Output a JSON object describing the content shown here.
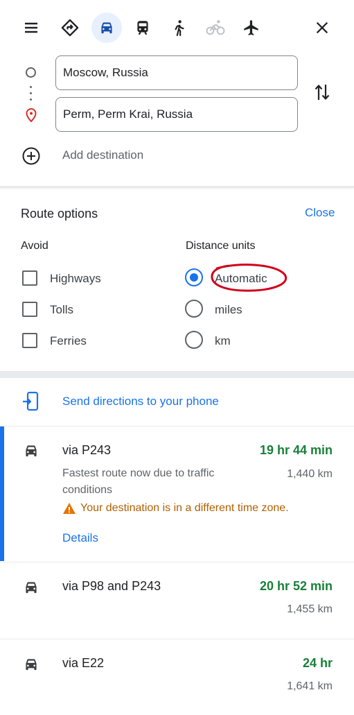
{
  "modes": {
    "menu_icon": "menu-icon",
    "items": [
      {
        "name": "best-route-icon"
      },
      {
        "name": "driving-icon",
        "active": true
      },
      {
        "name": "transit-icon"
      },
      {
        "name": "walking-icon"
      },
      {
        "name": "cycling-icon",
        "disabled": true
      },
      {
        "name": "flights-icon"
      }
    ],
    "close_icon": "close-icon"
  },
  "directions": {
    "origin": "Moscow, Russia",
    "destination": "Perm, Perm Krai, Russia",
    "add_destination": "Add destination"
  },
  "route_options": {
    "title": "Route options",
    "close": "Close",
    "avoid_label": "Avoid",
    "avoid": [
      "Highways",
      "Tolls",
      "Ferries"
    ],
    "units_label": "Distance units",
    "units": [
      "Automatic",
      "miles",
      "km"
    ],
    "selected_unit": "Automatic"
  },
  "send_to_phone": "Send directions to your phone",
  "routes": [
    {
      "name": "via P243",
      "time": "19 hr 44 min",
      "distance": "1,440 km",
      "description": "Fastest route now due to traffic conditions",
      "warning": "Your destination is in a different time zone.",
      "details": "Details"
    },
    {
      "name": "via P98 and P243",
      "time": "20 hr 52 min",
      "distance": "1,455 km"
    },
    {
      "name": "via E22",
      "time": "24 hr",
      "distance": "1,641 km"
    }
  ],
  "colors": {
    "accent": "#1a73e8",
    "time_green": "#188038",
    "warning": "#b06000",
    "annotation_red": "#d0021b"
  }
}
